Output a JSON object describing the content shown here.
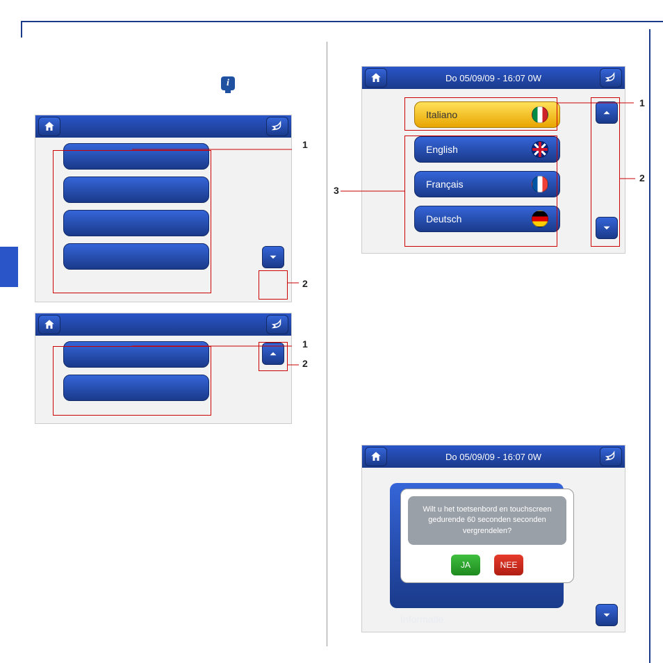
{
  "header_datetime": "Do 05/09/09 - 16:07   0W",
  "screen1": {
    "callout1": "1",
    "callout2": "2"
  },
  "screen2": {
    "callout1": "1",
    "callout2": "2"
  },
  "lang_screen": {
    "callout1": "1",
    "callout2": "2",
    "callout3": "3",
    "languages": [
      {
        "label": "Italiano",
        "flag": "it",
        "selected": true
      },
      {
        "label": "English",
        "flag": "en",
        "selected": false
      },
      {
        "label": "Français",
        "flag": "fr",
        "selected": false
      },
      {
        "label": "Deutsch",
        "flag": "de",
        "selected": false
      }
    ]
  },
  "dialog": {
    "message": "Wilt u het toetsenbord en touchscreen gedurende 60 seconden seconden vergrendelen?",
    "yes": "JA",
    "no": "NEE",
    "behind_label": "Informatie"
  }
}
